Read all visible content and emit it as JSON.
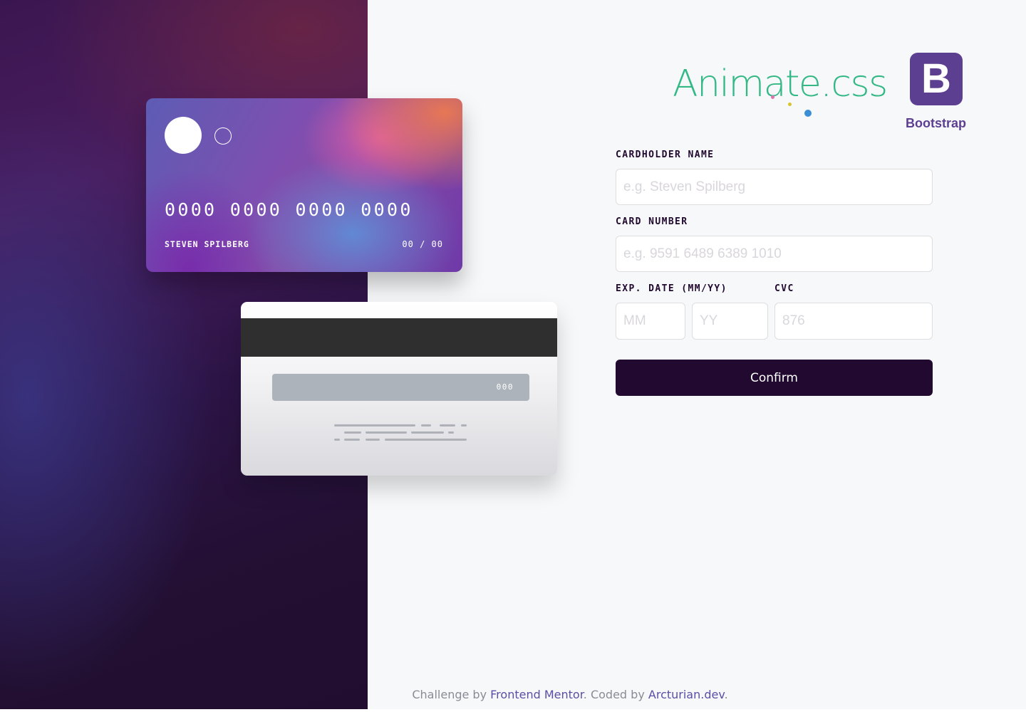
{
  "card_front": {
    "number": "0000 0000 0000 0000",
    "name": "STEVEN SPILBERG",
    "expiry": "00 / 00"
  },
  "card_back": {
    "cvc": "000"
  },
  "logos": {
    "animate": "Animate.css",
    "bootstrap_letter": "B",
    "bootstrap": "Bootstrap"
  },
  "form": {
    "cardholder_label": "CARDHOLDER NAME",
    "cardholder_placeholder": "e.g. Steven Spilberg",
    "cardholder_value": "",
    "number_label": "CARD NUMBER",
    "number_placeholder": "e.g. 9591 6489 6389 1010",
    "number_value": "",
    "exp_label": "EXP. DATE (MM/YY)",
    "month_placeholder": "MM",
    "year_placeholder": "YY",
    "cvc_label": "CVC",
    "cvc_placeholder": "876",
    "confirm_label": "Confirm"
  },
  "footer": {
    "prefix": "Challenge by ",
    "challenge_link": "Frontend Mentor",
    "middle": ". Coded by ",
    "coder_link": "Arcturian.dev",
    "suffix": "."
  },
  "colors": {
    "accent_dark": "#21092f",
    "bootstrap_purple": "#5d3f92",
    "animate_green": "#34b886",
    "link": "#5b4ea6"
  },
  "icons": [
    "card-logo-circle-large",
    "card-logo-circle-small",
    "bootstrap-icon"
  ]
}
